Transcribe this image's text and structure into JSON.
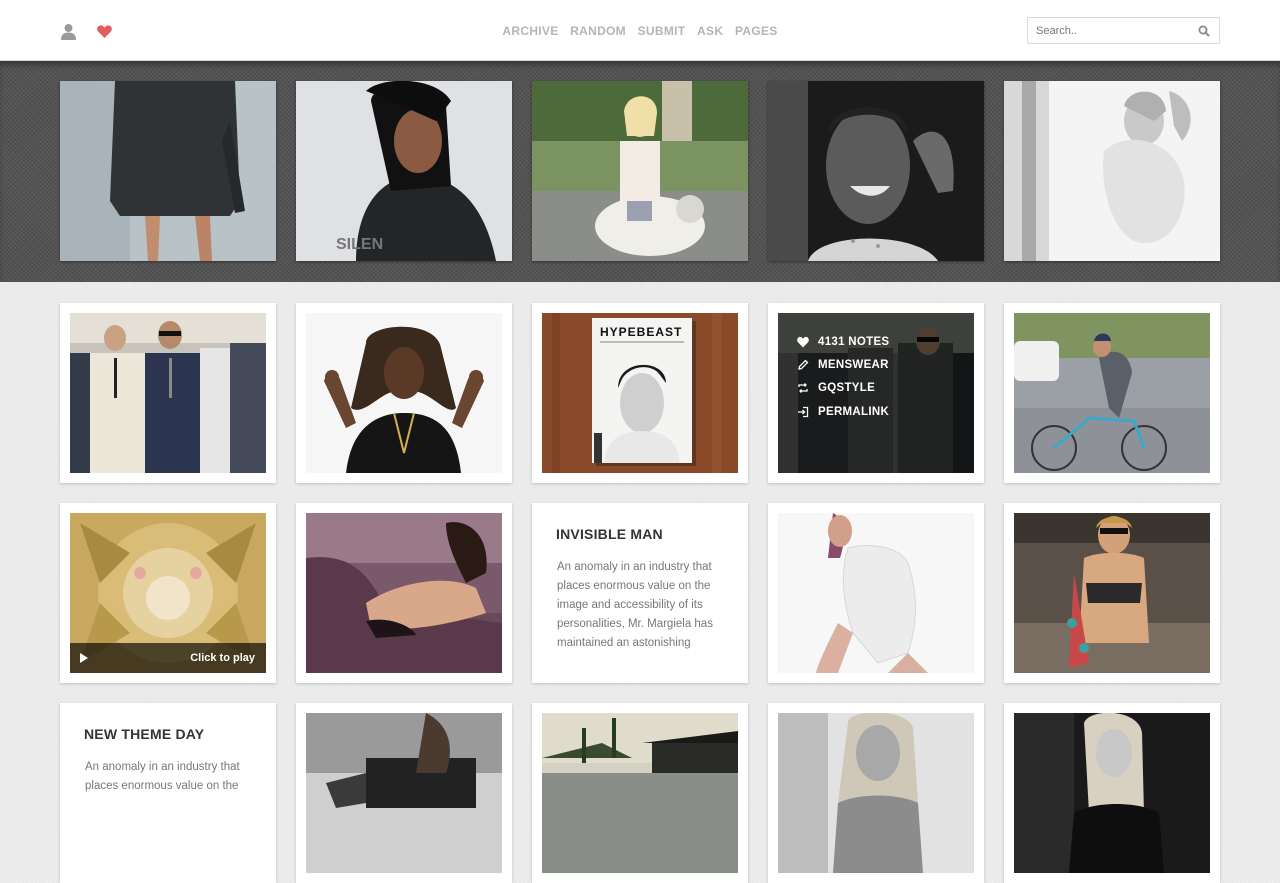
{
  "header": {
    "nav": [
      "ARCHIVE",
      "RANDOM",
      "SUBMIT",
      "ASK",
      "PAGES"
    ],
    "search_placeholder": "Search.."
  },
  "featured": [
    {
      "icon": "photo-icon",
      "alt": "woman in grey dress"
    },
    {
      "icon": "photo-icon",
      "alt": "woman in black jacket"
    },
    {
      "icon": "photo-icon",
      "alt": "woman on scooter"
    },
    {
      "icon": "photo-icon",
      "alt": "man smiling"
    },
    {
      "icon": "photo-icon",
      "alt": "woman in white"
    }
  ],
  "posts": {
    "hypebeast_magazine": "HYPEBEAST",
    "hover_menu": {
      "notes": "4131 NOTES",
      "tag1": "MENSWEAR",
      "tag2": "GQSTYLE",
      "permalink": "PERMALINK"
    },
    "video": {
      "play_label": "Click to play"
    },
    "text_posts": [
      {
        "title": "INVISIBLE MAN",
        "body": "An anomaly in an industry that places enormous value on the image and accessibility of its personalities, Mr. Margiela has maintained an astonishing"
      },
      {
        "title": "NEW THEME DAY",
        "body": "An anomaly in an industry that places enormous value on the"
      }
    ]
  },
  "colors": {
    "heart": "#e35e5e",
    "nav_text": "#b5b5b5",
    "band_bg": "#545454"
  }
}
